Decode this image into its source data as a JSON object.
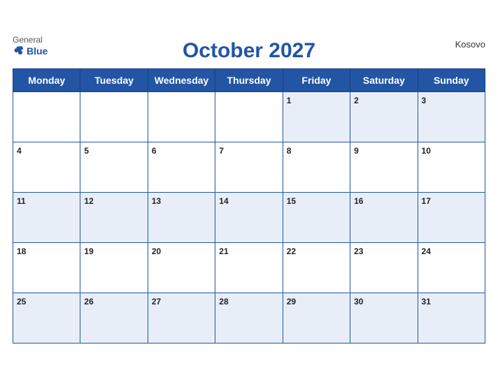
{
  "header": {
    "logo_general": "General",
    "logo_blue": "Blue",
    "title": "October 2027",
    "country": "Kosovo"
  },
  "weekdays": [
    "Monday",
    "Tuesday",
    "Wednesday",
    "Thursday",
    "Friday",
    "Saturday",
    "Sunday"
  ],
  "weeks": [
    [
      null,
      null,
      null,
      null,
      1,
      2,
      3
    ],
    [
      4,
      5,
      6,
      7,
      8,
      9,
      10
    ],
    [
      11,
      12,
      13,
      14,
      15,
      16,
      17
    ],
    [
      18,
      19,
      20,
      21,
      22,
      23,
      24
    ],
    [
      25,
      26,
      27,
      28,
      29,
      30,
      31
    ]
  ]
}
